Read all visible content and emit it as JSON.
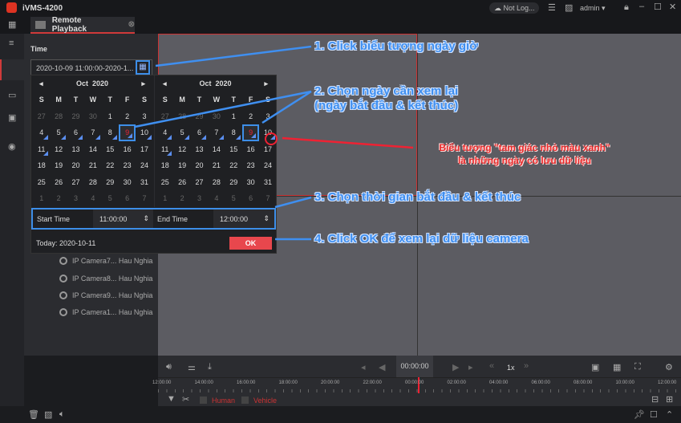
{
  "app": {
    "title": "iVMS-4200",
    "cloud_status": "Not Log...",
    "user": "admin"
  },
  "tab": {
    "label": "Remote Playback"
  },
  "panel": {
    "time_label": "Time",
    "time_value": "2020-10-09 11:00:00-2020-1...",
    "cameras": [
      {
        "name": "IP Camera7... Hau Nghia"
      },
      {
        "name": "IP Camera8... Hau Nghia"
      },
      {
        "name": "IP Camera9... Hau Nghia"
      },
      {
        "name": "IP Camera1... Hau Nghia"
      }
    ]
  },
  "calendar": {
    "left": {
      "month": "Oct",
      "year": "2020"
    },
    "right": {
      "month": "Oct",
      "year": "2020"
    },
    "weekdays": [
      "S",
      "M",
      "T",
      "W",
      "T",
      "F",
      "S"
    ],
    "days": [
      27,
      28,
      29,
      30,
      1,
      2,
      3,
      4,
      5,
      6,
      7,
      8,
      9,
      10,
      11,
      12,
      13,
      14,
      15,
      16,
      17,
      18,
      19,
      20,
      21,
      22,
      23,
      24,
      25,
      26,
      27,
      28,
      29,
      30,
      31,
      1,
      2,
      3,
      4,
      5,
      6,
      7
    ],
    "other_month_indices": [
      0,
      1,
      2,
      3,
      35,
      36,
      37,
      38,
      39,
      40,
      41
    ],
    "recorded_days": [
      4,
      5,
      6,
      7,
      8,
      9,
      10,
      11
    ],
    "selected_day": 9,
    "start_time_label": "Start Time",
    "start_time": "11:00:00",
    "end_time_label": "End Time",
    "end_time": "12:00:00",
    "today": "Today: 2020-10-11",
    "ok": "OK",
    "record_marker_color": "#5a8ef0"
  },
  "annotations": {
    "step1": "1. Click biểu tượng ngày giờ",
    "step2a": "2. Chọn ngày cần xem lại",
    "step2b": "(ngày bắt đầu & kết thúc)",
    "note1": "Biểu tượng \"tam giác nhỏ màu xanh\"",
    "note2": "là những ngày có lưu dữ liệu",
    "step3": "3. Chọn thời gian bắt đầu & kết thúc",
    "step4": "4. Click OK để xem lại dữ liệu camera"
  },
  "playback": {
    "time": "00:00:00",
    "speed": "1x",
    "timeline": [
      "12:00:00",
      "14:00:00",
      "16:00:00",
      "18:00:00",
      "20:00:00",
      "22:00:00",
      "00:00:00",
      "02:00:00",
      "04:00:00",
      "06:00:00",
      "08:00:00",
      "10:00:00",
      "12:00:00"
    ],
    "filters": [
      "Human",
      "Vehicle"
    ]
  },
  "colors": {
    "accent": "#d03a3a",
    "annotation_blue": "#3f8ff0"
  }
}
